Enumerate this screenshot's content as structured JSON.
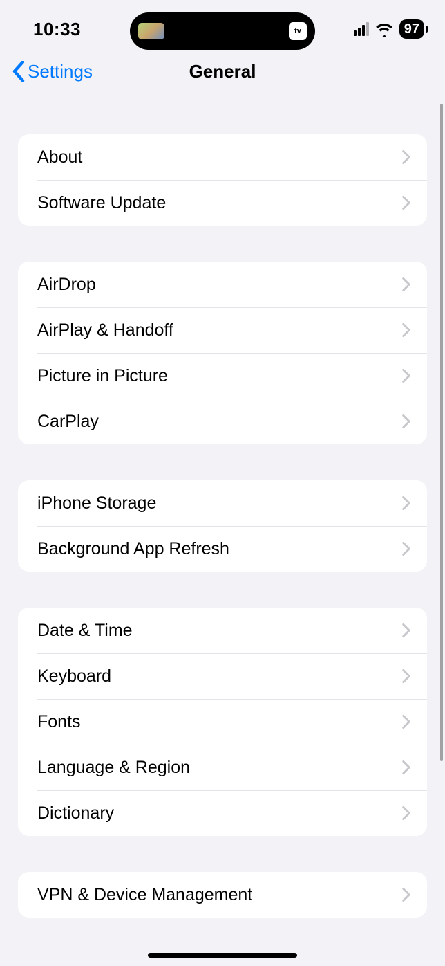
{
  "status": {
    "time": "10:33",
    "island_app": "tv",
    "battery": "97"
  },
  "nav": {
    "back_label": "Settings",
    "title": "General"
  },
  "groups": [
    {
      "items": [
        {
          "id": "about",
          "label": "About"
        },
        {
          "id": "software-update",
          "label": "Software Update"
        }
      ]
    },
    {
      "items": [
        {
          "id": "airdrop",
          "label": "AirDrop"
        },
        {
          "id": "airplay-handoff",
          "label": "AirPlay & Handoff"
        },
        {
          "id": "picture-in-picture",
          "label": "Picture in Picture"
        },
        {
          "id": "carplay",
          "label": "CarPlay"
        }
      ]
    },
    {
      "items": [
        {
          "id": "iphone-storage",
          "label": "iPhone Storage"
        },
        {
          "id": "background-app-refresh",
          "label": "Background App Refresh"
        }
      ]
    },
    {
      "items": [
        {
          "id": "date-time",
          "label": "Date & Time"
        },
        {
          "id": "keyboard",
          "label": "Keyboard"
        },
        {
          "id": "fonts",
          "label": "Fonts"
        },
        {
          "id": "language-region",
          "label": "Language & Region"
        },
        {
          "id": "dictionary",
          "label": "Dictionary"
        }
      ]
    },
    {
      "items": [
        {
          "id": "vpn-device-management",
          "label": "VPN & Device Management"
        }
      ]
    }
  ]
}
